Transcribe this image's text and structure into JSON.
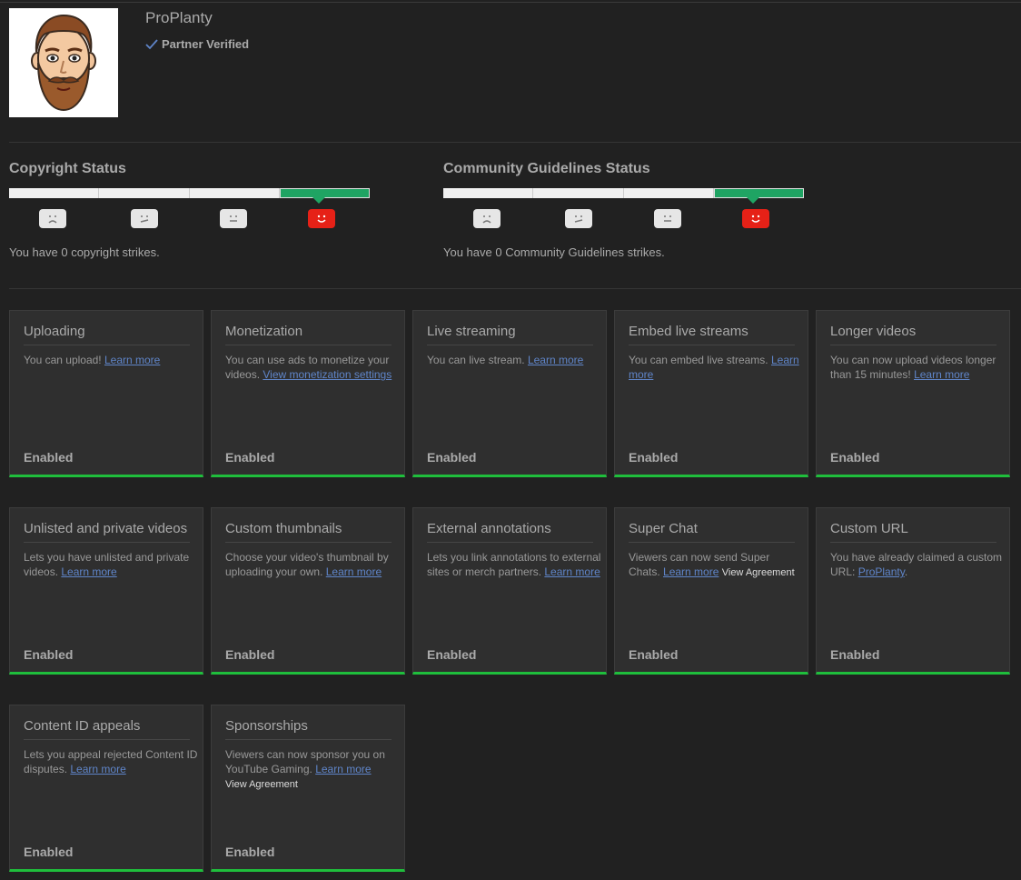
{
  "channel": {
    "name": "ProPlanty",
    "verified_label": "Partner Verified"
  },
  "copyright": {
    "title": "Copyright Status",
    "strikes_text": "You have 0 copyright strikes."
  },
  "community": {
    "title": "Community Guidelines Status",
    "strikes_text": "You have 0 Community Guidelines strikes."
  },
  "colors": {
    "good": "#1fa463",
    "enabled_bar": "#1fbe3c",
    "link": "#5f85c9",
    "face_active": "#e62117"
  },
  "features": [
    {
      "title": "Uploading",
      "desc": "You can upload! ",
      "link1": "Learn more",
      "desc2": "",
      "link2": "",
      "extra": "",
      "state": "Enabled"
    },
    {
      "title": "Monetization",
      "desc": "You can use ads to monetize your videos. ",
      "link1": "View monetization settings",
      "desc2": "",
      "link2": "",
      "extra": "",
      "state": "Enabled"
    },
    {
      "title": "Live streaming",
      "desc": "You can live stream. ",
      "link1": "Learn more",
      "desc2": "",
      "link2": "",
      "extra": "",
      "state": "Enabled"
    },
    {
      "title": "Embed live streams",
      "desc": "You can embed live streams. ",
      "link1": "Learn more",
      "desc2": "",
      "link2": "",
      "extra": "",
      "state": "Enabled"
    },
    {
      "title": "Longer videos",
      "desc": "You can now upload videos longer than 15 minutes! ",
      "link1": "Learn more",
      "desc2": "",
      "link2": "",
      "extra": "",
      "state": "Enabled"
    },
    {
      "title": "Unlisted and private videos",
      "desc": "Lets you have unlisted and private videos. ",
      "link1": "Learn more",
      "desc2": "",
      "link2": "",
      "extra": "",
      "state": "Enabled"
    },
    {
      "title": "Custom thumbnails",
      "desc": "Choose your video's thumbnail by uploading your own. ",
      "link1": "Learn more",
      "desc2": "",
      "link2": "",
      "extra": "",
      "state": "Enabled"
    },
    {
      "title": "External annotations",
      "desc": "Lets you link annotations to external sites or merch partners. ",
      "link1": "Learn more",
      "desc2": "",
      "link2": "",
      "extra": "",
      "state": "Enabled"
    },
    {
      "title": "Super Chat",
      "desc": "Viewers can now send Super Chats. ",
      "link1": "Learn more",
      "desc2": " ",
      "link2": "",
      "extra": "View Agreement",
      "state": "Enabled"
    },
    {
      "title": "Custom URL",
      "desc": "You have already claimed a custom URL: ",
      "link1": "ProPlanty",
      "desc2": ".",
      "link2": "",
      "extra": "",
      "state": "Enabled"
    },
    {
      "title": "Content ID appeals",
      "desc": "Lets you appeal rejected Content ID disputes. ",
      "link1": "Learn more",
      "desc2": "",
      "link2": "",
      "extra": "",
      "state": "Enabled"
    },
    {
      "title": "Sponsorships",
      "desc": "Viewers can now sponsor you on YouTube Gaming. ",
      "link1": "Learn more",
      "desc2": "",
      "link2": "",
      "extra": "View Agreement",
      "extra_block": true,
      "state": "Enabled"
    }
  ]
}
